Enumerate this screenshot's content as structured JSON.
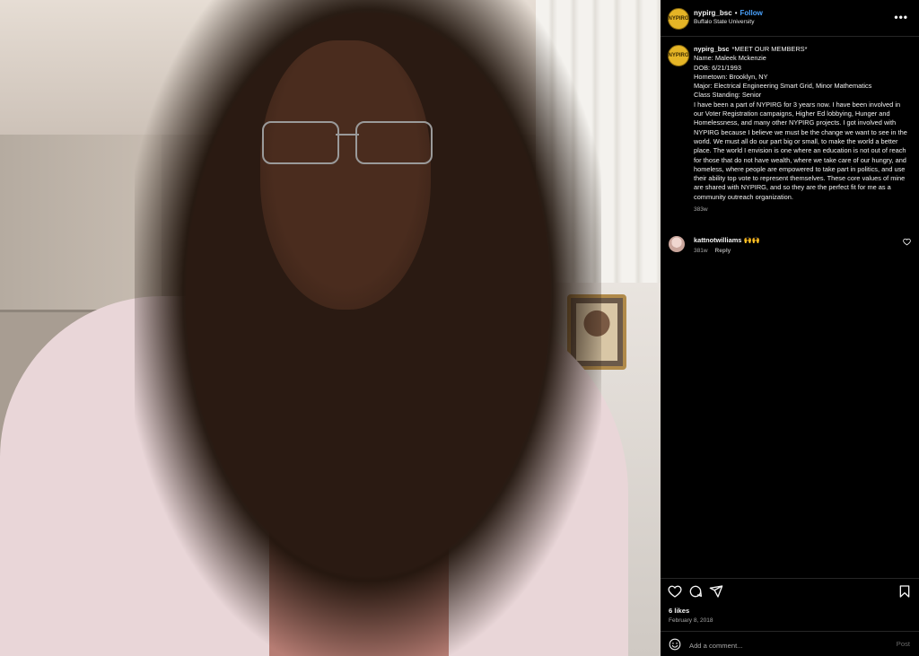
{
  "post": {
    "username": "nypirg_bsc",
    "separator": "•",
    "follow_label": "Follow",
    "location": "Buffalo State University",
    "more_icon": "more-horizontal-icon",
    "avatar_text": "NYPIRG",
    "accent": "#4aa3ff"
  },
  "caption": {
    "username": "nypirg_bsc",
    "lines": [
      "*MEET OUR MEMBERS*",
      "Name: Maleek Mckenzie",
      "DOB: 6/21/1993",
      "Hometown: Brooklyn, NY",
      "Major: Electrical Engineering Smart Grid, Minor Mathematics",
      "Class Standing: Senior",
      "I have been a part of NYPIRG for 3 years now. I have been involved in our Voter Registration campaigns, Higher Ed lobbying, Hunger and Homelessness, and many other NYPIRG projects. I got involved with NYPIRG because I believe we must be the change we want to see in the world. We must all do our part big or small, to make the world a better place. The world I envision is one where an education is not out of reach for those that do not have wealth, where we take care of our hungry, and homeless, where people are empowered to take part in politics, and use their ability top vote to represent themselves. These core values of mine are shared with NYPIRG, and so they are the perfect fit for me as a community outreach organization."
    ],
    "time": "383w"
  },
  "comments": [
    {
      "username": "kattnotwilliams",
      "text": "🙌🙌",
      "time": "381w",
      "reply_label": "Reply"
    }
  ],
  "actions": {
    "like_icon": "heart-icon",
    "comment_icon": "comment-icon",
    "share_icon": "send-icon",
    "save_icon": "bookmark-icon"
  },
  "likes": "6 likes",
  "date": "February 8, 2018",
  "add_comment": {
    "placeholder": "Add a comment...",
    "post_label": "Post"
  }
}
